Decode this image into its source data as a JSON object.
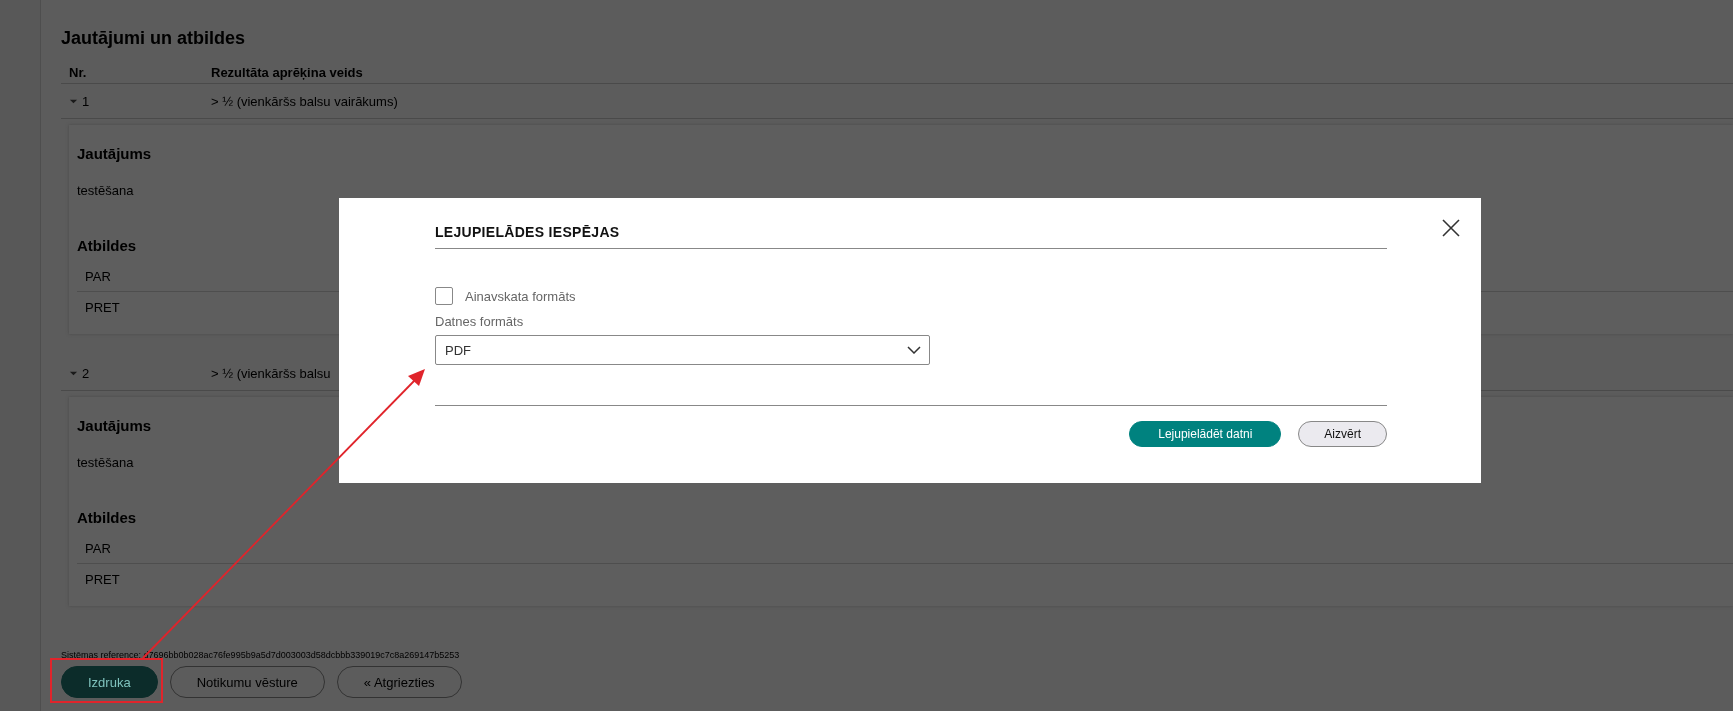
{
  "page": {
    "section_title": "Jautājumi un atbildes",
    "columns": [
      "Nr.",
      "Rezultāta aprēķina veids"
    ],
    "questions": [
      {
        "number": "1",
        "expanded": true,
        "method": "> ½ (vienkāršs balsu vairākums)",
        "question_label": "Jautājums",
        "question_text": "testēšana",
        "answers_label": "Atbildes",
        "answers": [
          "PAR",
          "PRET"
        ]
      },
      {
        "number": "2",
        "expanded": true,
        "method": "> ½ (vienkāršs balsu",
        "question_label": "Jautājums",
        "question_text": "testēšana",
        "answers_label": "Atbildes",
        "answers": [
          "PAR",
          "PRET"
        ]
      }
    ],
    "system_reference": "Sistēmas reference: d7696bb0b028ac76fe995b9a5d7d003003d58dcbbb339019c7c8a269147b5253",
    "buttons": [
      {
        "label": "Izdruka",
        "kind": "primary"
      },
      {
        "label": "Notikumu vēsture",
        "kind": "secondary"
      },
      {
        "label": "« Atgriezties",
        "kind": "secondary"
      }
    ]
  },
  "dialog": {
    "title": "LEJUPIELĀDES IESPĒJAS",
    "landscape": {
      "label": "Ainavskata formāts",
      "checked": false
    },
    "file_format": {
      "label": "Datnes formāts",
      "value": "PDF"
    },
    "buttons": [
      {
        "label": "Lejupielādēt datni",
        "kind": "primary"
      },
      {
        "label": "Aizvērt",
        "kind": "secondary"
      }
    ]
  }
}
